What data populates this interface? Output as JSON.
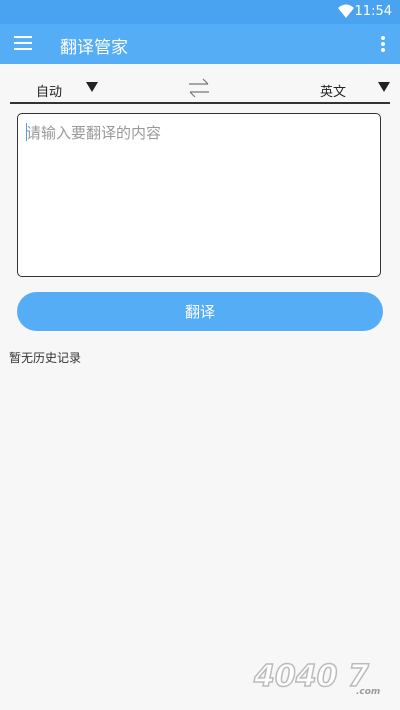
{
  "status_bar": {
    "time": "11:54",
    "wifi_icon": "wifi-icon"
  },
  "app_bar": {
    "title": "翻译管家",
    "menu_icon": "menu-icon",
    "more_icon": "more-vert-icon",
    "color": "#55adf5"
  },
  "language": {
    "source": "自动",
    "target": "英文",
    "swap_icon": "swap-icon"
  },
  "input": {
    "placeholder": "请输入要翻译的内容",
    "value": ""
  },
  "translate_button": {
    "label": "翻译"
  },
  "history": {
    "empty_text": "暂无历史记录"
  },
  "watermark": {
    "text": "40407.com"
  }
}
